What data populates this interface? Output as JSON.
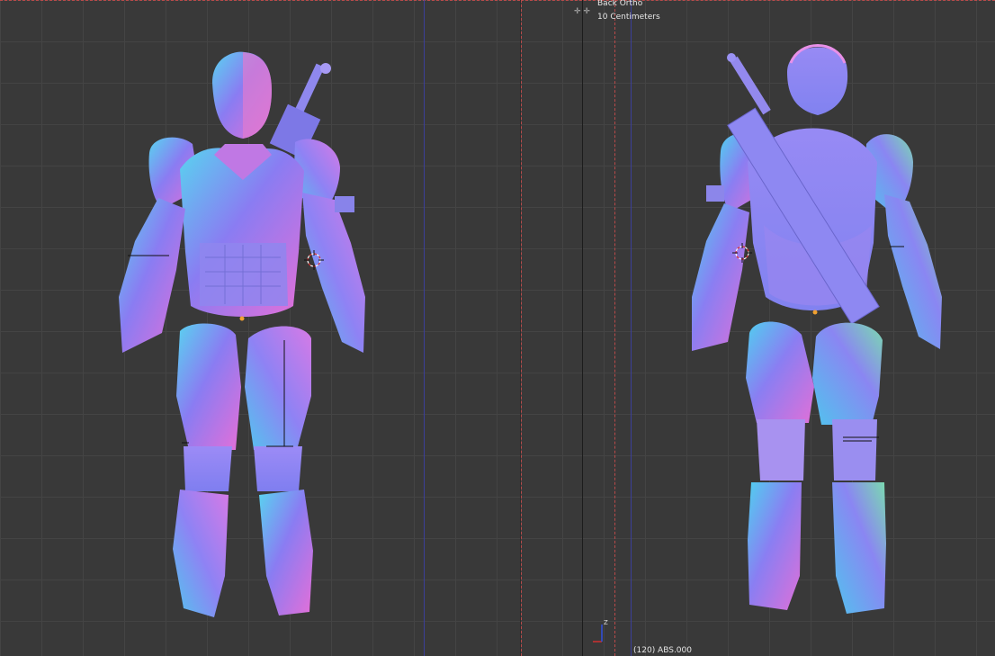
{
  "right_viewport": {
    "view_label": "Back Ortho",
    "scale_label": "10 Centimeters",
    "frame_info": "(120) ABS.000"
  },
  "icons": {
    "split_handle": "split-handle-icon",
    "axis_gizmo": "axis-gizmo-icon",
    "cursor": "3d-cursor-icon"
  },
  "colors": {
    "background": "#393939",
    "grid": "#444444",
    "dashed_guides": "#b94a4a",
    "model_base": "#8c7cf0",
    "model_cyan": "#4fd0f0",
    "model_pink": "#e070d8"
  }
}
